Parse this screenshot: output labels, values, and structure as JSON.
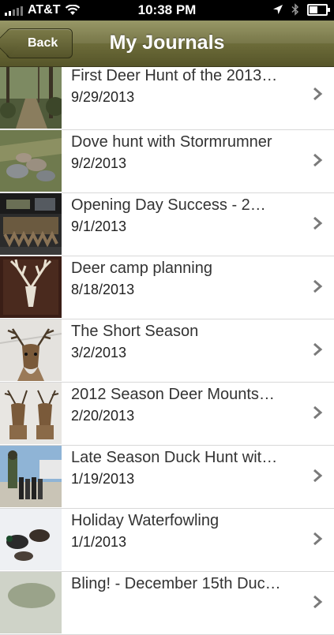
{
  "status_bar": {
    "carrier": "AT&T",
    "time": "10:38 PM"
  },
  "nav": {
    "back_label": "Back",
    "title": "My Journals"
  },
  "journals": [
    {
      "title": "First Deer Hunt of the 2013…",
      "date": "9/29/2013",
      "thumb": "woods-path"
    },
    {
      "title": "Dove hunt with Stormrumner",
      "date": "9/2/2013",
      "thumb": "doves-on-grass"
    },
    {
      "title": "Opening Day Success - 2…",
      "date": "9/1/2013",
      "thumb": "truck-tailgate-birds"
    },
    {
      "title": "Deer camp planning",
      "date": "8/18/2013",
      "thumb": "antler-skull-mount"
    },
    {
      "title": "The Short Season",
      "date": "3/2/2013",
      "thumb": "deer-head-mount"
    },
    {
      "title": "2012 Season Deer Mounts…",
      "date": "2/20/2013",
      "thumb": "two-deer-mounts"
    },
    {
      "title": "Late Season Duck Hunt wit…",
      "date": "1/19/2013",
      "thumb": "hunters-with-ducks"
    },
    {
      "title": "Holiday Waterfowling",
      "date": "1/1/2013",
      "thumb": "ducks-on-snow"
    },
    {
      "title": "Bling! - December 15th Duc…",
      "date": "",
      "thumb": "duck-band"
    }
  ]
}
